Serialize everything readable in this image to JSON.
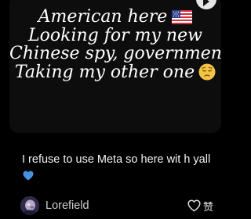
{
  "video": {
    "overlay_lines": [
      "American here",
      "Looking for my new",
      "Chinese spy, government",
      "Taking my other one"
    ],
    "icons": {
      "play": "play-icon",
      "flag": "us-flag-icon",
      "sad": "pensive-face-icon"
    }
  },
  "post": {
    "caption": "I refuse to use Meta so here wit h yall",
    "caption_emoji": "blue-heart-icon",
    "author": "Lorefield",
    "like_label": "赞"
  },
  "colors": {
    "background": "#000000",
    "card": "#0d0d0d",
    "heart": "#4a90e2"
  }
}
